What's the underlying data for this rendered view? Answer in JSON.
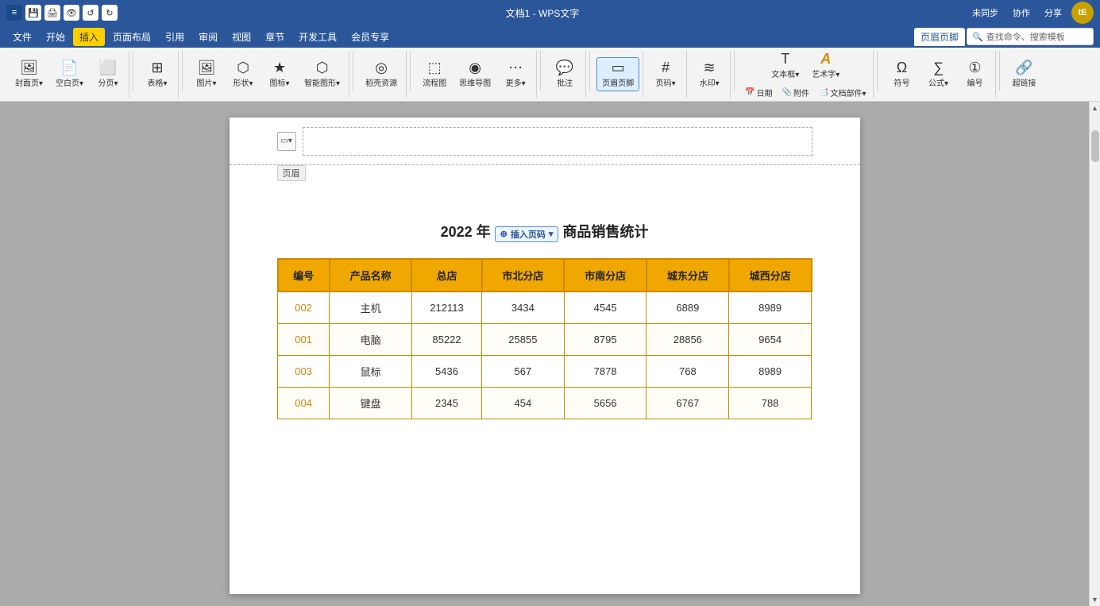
{
  "titlebar": {
    "buttons": [
      "≡",
      "□",
      "⟳",
      "↺",
      "↻"
    ],
    "doc_title": "文档1 - WPS文字",
    "sync_btn": "未同步",
    "collab_btn": "协作",
    "share_btn": "分享",
    "user_initials": "tE"
  },
  "menubar": {
    "items": [
      "文件",
      "开始",
      "插入",
      "页面布局",
      "引用",
      "审阅",
      "视图",
      "章节",
      "开发工具",
      "会员专享"
    ],
    "active": "插入",
    "right_items": [
      "页眉页脚",
      "查找命令、搜索模板"
    ]
  },
  "toolbar": {
    "groups": [
      {
        "name": "cover",
        "buttons": [
          {
            "label": "封面页",
            "icon": "🖼",
            "has_dropdown": true
          },
          {
            "label": "空白页",
            "icon": "📄",
            "has_dropdown": true
          },
          {
            "label": "分页",
            "icon": "⬜",
            "has_dropdown": true
          }
        ]
      },
      {
        "name": "table",
        "buttons": [
          {
            "label": "表格",
            "icon": "⊞",
            "has_dropdown": true
          }
        ]
      },
      {
        "name": "image",
        "buttons": [
          {
            "label": "图片",
            "icon": "🖼",
            "has_dropdown": true
          },
          {
            "label": "形状",
            "icon": "⬡",
            "has_dropdown": true
          },
          {
            "label": "图标",
            "icon": "★",
            "has_dropdown": true
          },
          {
            "label": "智能图形",
            "icon": "⬡",
            "has_dropdown": true
          }
        ]
      },
      {
        "name": "resource",
        "buttons": [
          {
            "label": "稻壳资源",
            "icon": "◎"
          }
        ]
      },
      {
        "name": "flow",
        "buttons": [
          {
            "label": "流程图",
            "icon": "⬚"
          },
          {
            "label": "思维导图",
            "icon": "◉"
          },
          {
            "label": "更多",
            "icon": "⋯",
            "has_dropdown": true
          }
        ]
      },
      {
        "name": "comment",
        "buttons": [
          {
            "label": "批注",
            "icon": "💬"
          }
        ]
      },
      {
        "name": "header_footer",
        "buttons": [
          {
            "label": "页眉页脚",
            "icon": "▭",
            "active": true
          }
        ]
      },
      {
        "name": "pageno",
        "buttons": [
          {
            "label": "页码",
            "icon": "#",
            "has_dropdown": true
          }
        ]
      },
      {
        "name": "watermark",
        "buttons": [
          {
            "label": "水印",
            "icon": "≋",
            "has_dropdown": true
          }
        ]
      },
      {
        "name": "textbox",
        "buttons": [
          {
            "label": "文本框",
            "icon": "T",
            "has_dropdown": true
          }
        ]
      },
      {
        "name": "art_text",
        "buttons": [
          {
            "label": "艺术字",
            "icon": "A",
            "has_dropdown": true
          }
        ]
      },
      {
        "name": "date",
        "buttons": [
          {
            "label": "日期",
            "icon": "📅"
          }
        ]
      },
      {
        "name": "attachment",
        "buttons": [
          {
            "label": "附件",
            "icon": "📎"
          }
        ]
      },
      {
        "name": "docpart",
        "buttons": [
          {
            "label": "文档部件",
            "icon": "📑",
            "has_dropdown": true
          }
        ]
      },
      {
        "name": "symbol",
        "buttons": [
          {
            "label": "符号",
            "icon": "Ω"
          }
        ]
      },
      {
        "name": "formula",
        "buttons": [
          {
            "label": "公式",
            "icon": "∑",
            "has_dropdown": true
          }
        ]
      },
      {
        "name": "edit",
        "buttons": [
          {
            "label": "编号",
            "icon": "①"
          }
        ]
      },
      {
        "name": "hyperlink",
        "buttons": [
          {
            "label": "超链接",
            "icon": "🔗"
          }
        ]
      }
    ]
  },
  "page": {
    "header_label": "页眉",
    "insert_pageno_label": "插入页码",
    "doc_title": "2022 年 ×× 商品销售统计",
    "table": {
      "headers": [
        "编号",
        "产品名称",
        "总店",
        "市北分店",
        "市南分店",
        "城东分店",
        "城西分店"
      ],
      "rows": [
        [
          "002",
          "主机",
          "212113",
          "3434",
          "4545",
          "6889",
          "8989"
        ],
        [
          "001",
          "电脑",
          "85222",
          "25855",
          "8795",
          "28856",
          "9654"
        ],
        [
          "003",
          "鼠标",
          "5436",
          "567",
          "7878",
          "768",
          "8989"
        ],
        [
          "004",
          "键盘",
          "2345",
          "454",
          "5656",
          "6767",
          "788"
        ]
      ]
    }
  },
  "colors": {
    "toolbar_active": "#2b579a",
    "table_header_bg": "#f0a800",
    "table_border": "#d08800",
    "menu_active_bg": "#ffffff",
    "menu_highlight": "#ffd000"
  }
}
